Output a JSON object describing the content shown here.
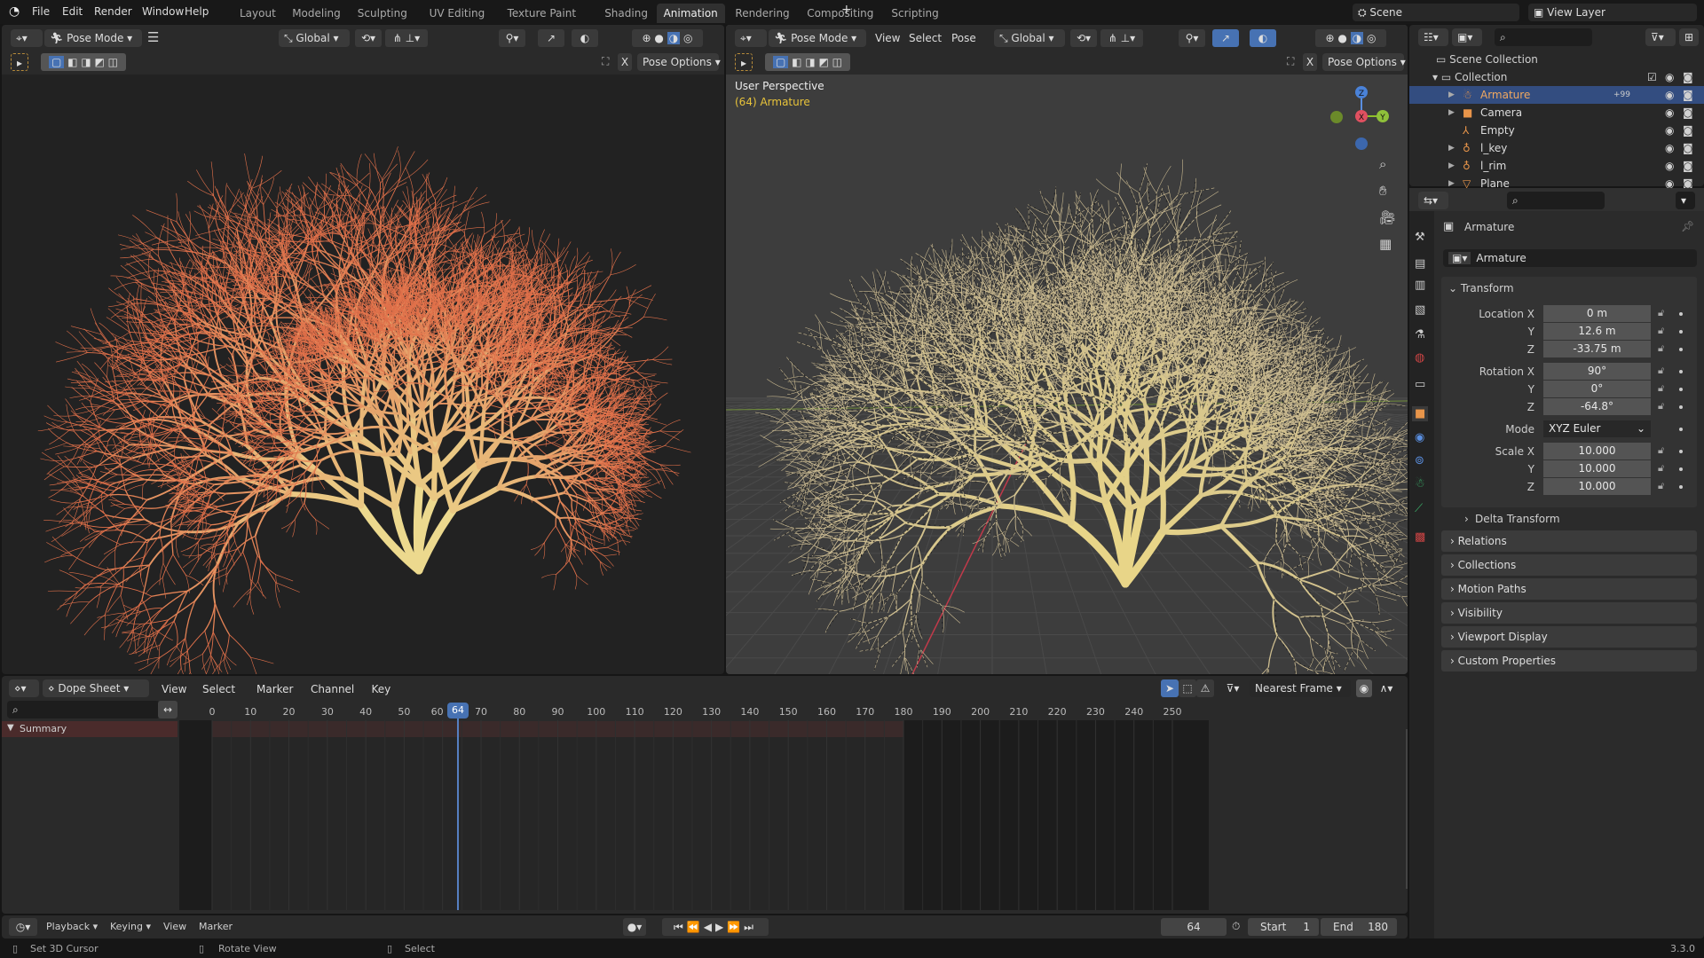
{
  "topbar": {
    "menus": [
      "File",
      "Edit",
      "Render",
      "Window",
      "Help"
    ],
    "workspaces": [
      "Layout",
      "Modeling",
      "Sculpting",
      "UV Editing",
      "Texture Paint",
      "Shading",
      "Animation",
      "Rendering",
      "Compositing",
      "Scripting"
    ],
    "active_workspace": "Animation",
    "add_tab": "+",
    "scene": "Scene",
    "view_layer": "View Layer"
  },
  "left_viewport": {
    "mode": "Pose Mode",
    "orientation": "Global",
    "pose_options": "Pose Options",
    "x_mirror": "X"
  },
  "right_viewport": {
    "mode": "Pose Mode",
    "menus": [
      "View",
      "Select",
      "Pose"
    ],
    "orientation": "Global",
    "pose_options": "Pose Options",
    "x_mirror": "X",
    "perspective_label": "User Perspective",
    "object_label": "(64) Armature",
    "gizmo": {
      "z": "Z",
      "x": "X",
      "y": "Y"
    }
  },
  "outliner": {
    "root": "Scene Collection",
    "collection": "Collection",
    "items": [
      {
        "name": "Armature",
        "icon": "armature-icon",
        "color": "#e8954a",
        "selected": true,
        "badge": "+99"
      },
      {
        "name": "Camera",
        "icon": "camera-icon",
        "color": "#e8954a",
        "selected": false
      },
      {
        "name": "Empty",
        "icon": "empty-icon",
        "color": "#e8954a",
        "selected": false
      },
      {
        "name": "l_key",
        "icon": "light-icon",
        "color": "#e8954a",
        "selected": false
      },
      {
        "name": "l_rim",
        "icon": "light-icon",
        "color": "#e8954a",
        "selected": false
      },
      {
        "name": "Plane",
        "icon": "mesh-icon",
        "color": "#e8954a",
        "selected": false
      }
    ]
  },
  "properties": {
    "object_name": "Armature",
    "name_field": "Armature",
    "transform_title": "Transform",
    "location": {
      "label": "Location X",
      "x": "0 m",
      "y": "12.6 m",
      "z": "-33.75 m"
    },
    "rotation": {
      "label": "Rotation X",
      "x": "90°",
      "y": "0°",
      "z": "-64.8°"
    },
    "mode": {
      "label": "Mode",
      "value": "XYZ Euler"
    },
    "scale": {
      "label": "Scale X",
      "x": "10.000",
      "y": "10.000",
      "z": "10.000"
    },
    "axis_y": "Y",
    "axis_z": "Z",
    "delta": "Delta Transform",
    "panels": [
      "Relations",
      "Collections",
      "Motion Paths",
      "Visibility",
      "Viewport Display",
      "Custom Properties"
    ]
  },
  "dopesheet": {
    "editor": "Dope Sheet",
    "menus": [
      "View",
      "Select",
      "Marker",
      "Channel",
      "Key"
    ],
    "snap": "Nearest Frame",
    "summary": "Summary",
    "ticks": [
      "0",
      "10",
      "20",
      "30",
      "40",
      "50",
      "60",
      "70",
      "80",
      "90",
      "100",
      "110",
      "120",
      "130",
      "140",
      "150",
      "160",
      "170",
      "180",
      "190",
      "200",
      "210",
      "220",
      "230",
      "240",
      "250"
    ],
    "current_frame": 64,
    "current_frame_label": "64",
    "scene_end": 180
  },
  "playback": {
    "menus": [
      "Playback",
      "Keying",
      "View",
      "Marker"
    ],
    "frame": "64",
    "start_label": "Start",
    "start": "1",
    "end_label": "End",
    "end": "180"
  },
  "status": {
    "left": "Set 3D Cursor",
    "middle": "Rotate View",
    "right": "Select",
    "version": "3.3.0"
  },
  "colors": {
    "accent": "#4772b3",
    "selection": "#334d80",
    "frame_line": "#5680c2",
    "tree_tip": "#e0704a",
    "tree_base": "#ecd98e"
  }
}
